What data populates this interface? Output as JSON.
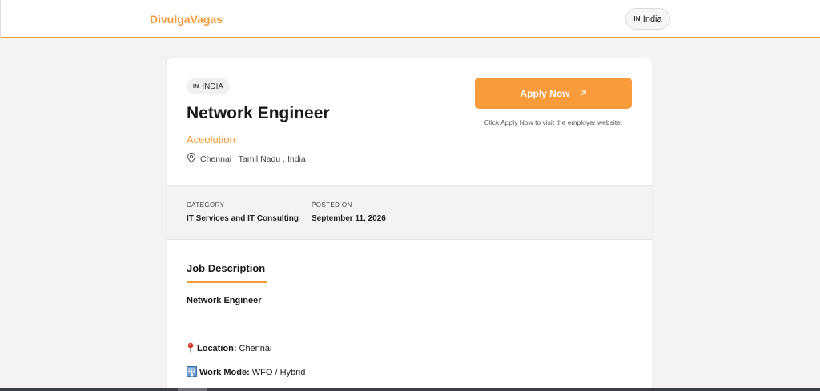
{
  "header": {
    "brand": "DivulgaVagas",
    "country_code": "IN",
    "country_name": "India"
  },
  "job": {
    "country_badge_code": "IN",
    "country_badge_label": "INDIA",
    "title": "Network Engineer",
    "company": "Aceolution",
    "location": "Chennai , Tamil Nadu , India",
    "apply_label": "Apply Now",
    "apply_note": "Click Apply Now to visit the employer website."
  },
  "meta": {
    "category_label": "CATEGORY",
    "category_value": "IT Services and IT Consulting",
    "posted_label": "POSTED ON",
    "posted_value": "September 11, 2026"
  },
  "description": {
    "heading": "Job Description",
    "role_title": "Network Engineer",
    "location_label": "Location:",
    "location_value": "Chennai",
    "work_mode_label": "Work Mode:",
    "work_mode_value": "WFO / Hybrid"
  },
  "colors": {
    "accent": "#f59b3a",
    "button": "#f99b3a"
  },
  "icons": {
    "location": "map-pin-icon",
    "external": "arrow-up-right-icon",
    "pin_emoji": "round-pushpin-icon",
    "building_emoji": "office-building-icon"
  }
}
